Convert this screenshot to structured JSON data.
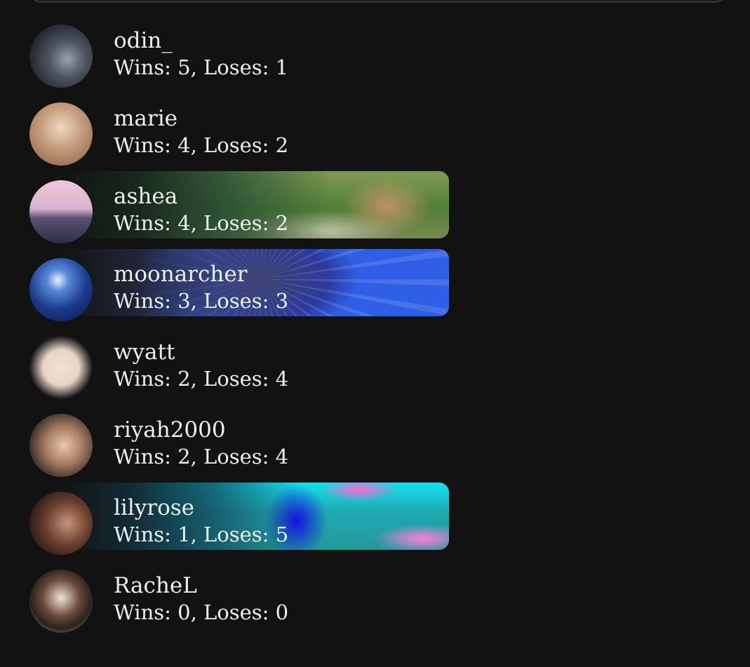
{
  "leaderboard": [
    {
      "username": "odin_",
      "record": "Wins: 5, Loses: 1"
    },
    {
      "username": "marie",
      "record": "Wins: 4, Loses: 2"
    },
    {
      "username": "ashea",
      "record": "Wins: 4, Loses: 2"
    },
    {
      "username": "moonarcher",
      "record": "Wins: 3, Loses: 3"
    },
    {
      "username": "wyatt",
      "record": "Wins: 2, Loses: 4"
    },
    {
      "username": "riyah2000",
      "record": "Wins: 2, Loses: 4"
    },
    {
      "username": "lilyrose",
      "record": "Wins: 1, Loses: 5"
    },
    {
      "username": "RacheL",
      "record": "Wins: 0, Loses: 0"
    }
  ]
}
